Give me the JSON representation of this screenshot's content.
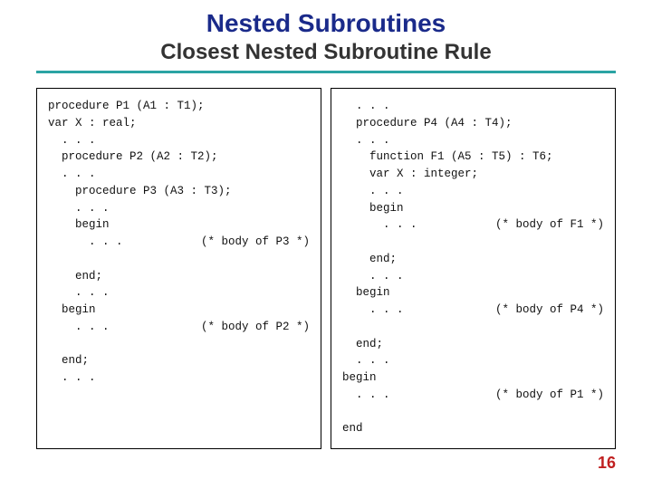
{
  "title": "Nested Subroutines",
  "subtitle": "Closest Nested Subroutine Rule",
  "page_number": "16",
  "left_code": {
    "l0": "procedure P1 (A1 : T1);",
    "l1": "var X : real;",
    "l2": "  . . .",
    "l3": "  procedure P2 (A2 : T2);",
    "l4": "  . . .",
    "l5": "    procedure P3 (A3 : T3);",
    "l6": "    . . .",
    "l7": "    begin",
    "l8": "      . . .",
    "l8c": "(* body of P3 *)",
    "l9": "    end;",
    "l10": "    . . .",
    "l11": "  begin",
    "l12": "    . . .",
    "l12c": "(* body of P2 *)",
    "l13": "  end;",
    "l14": "  . . ."
  },
  "right_code": {
    "r0": "  . . .",
    "r1": "  procedure P4 (A4 : T4);",
    "r2": "  . . .",
    "r3": "    function F1 (A5 : T5) : T6;",
    "r4": "    var X : integer;",
    "r5": "    . . .",
    "r6": "    begin",
    "r7": "      . . .",
    "r7c": "(* body of F1 *)",
    "r8": "    end;",
    "r9": "    . . .",
    "r10": "  begin",
    "r11": "    . . .",
    "r11c": "(* body of P4 *)",
    "r12": "  end;",
    "r13": "  . . .",
    "r14": "begin",
    "r15": "  . . .",
    "r15c": "(* body of P1 *)",
    "r16": "end"
  }
}
